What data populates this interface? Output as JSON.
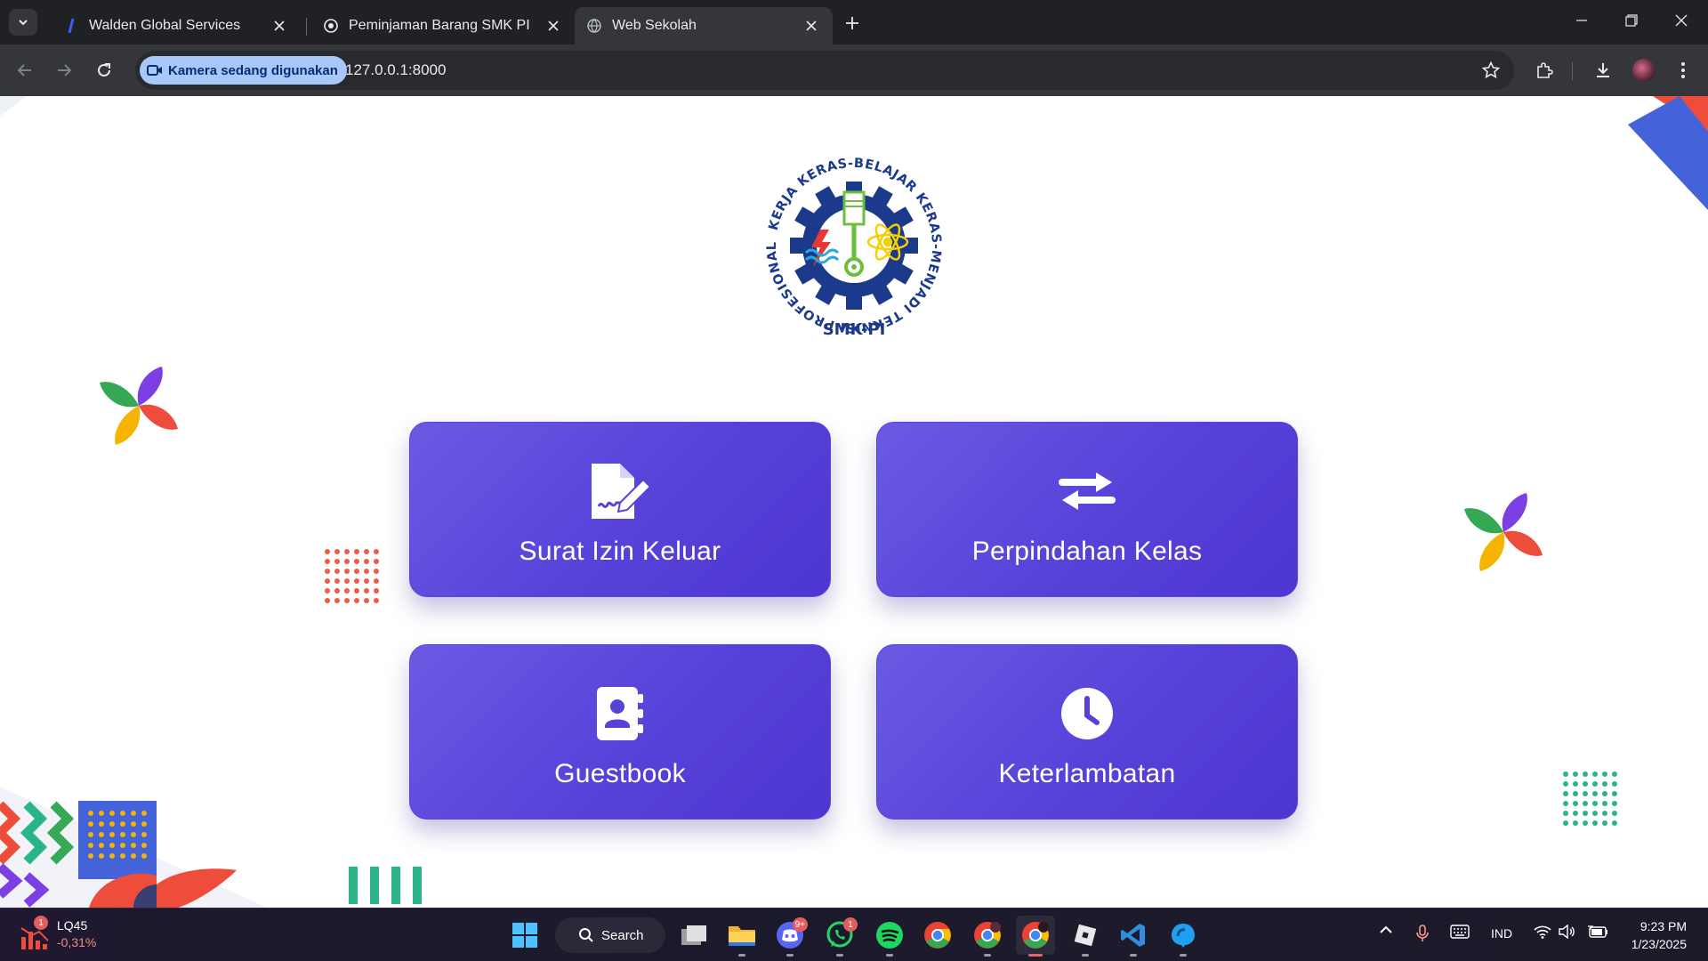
{
  "browser": {
    "tabs": [
      {
        "title": "Walden Global Services",
        "active": false
      },
      {
        "title": "Peminjaman Barang SMK PI",
        "active": false
      },
      {
        "title": "Web Sekolah",
        "active": true
      }
    ],
    "camera_chip": "Kamera sedang digunakan",
    "url": "127.0.0.1:8000"
  },
  "page": {
    "logo": {
      "ring_text": "KERJA KERAS-BELAJAR KERAS-MENJADI TEKNISI PROFESIONAL",
      "name": "SMK-PI"
    },
    "menu": [
      {
        "label": "Surat Izin Keluar",
        "icon": "document-signature-icon"
      },
      {
        "label": "Perpindahan Kelas",
        "icon": "swap-arrows-icon"
      },
      {
        "label": "Guestbook",
        "icon": "address-book-icon"
      },
      {
        "label": "Keterlambatan",
        "icon": "clock-icon"
      }
    ],
    "accent": "#5742d9"
  },
  "taskbar": {
    "stock": {
      "badge": "1",
      "ticker": "LQ45",
      "change": "-0,31%"
    },
    "search_label": "Search",
    "apps": [
      {
        "name": "task-view",
        "badge": ""
      },
      {
        "name": "file-explorer",
        "badge": ""
      },
      {
        "name": "discord",
        "badge": "9+"
      },
      {
        "name": "whatsapp",
        "badge": "1"
      },
      {
        "name": "spotify",
        "badge": ""
      },
      {
        "name": "chrome",
        "badge": ""
      },
      {
        "name": "chrome-profile",
        "badge": ""
      },
      {
        "name": "chrome-active",
        "badge": ""
      },
      {
        "name": "roblox",
        "badge": ""
      },
      {
        "name": "vscode",
        "badge": ""
      },
      {
        "name": "edge-app",
        "badge": ""
      }
    ],
    "language": "IND",
    "time": "9:23 PM",
    "date": "1/23/2025"
  }
}
